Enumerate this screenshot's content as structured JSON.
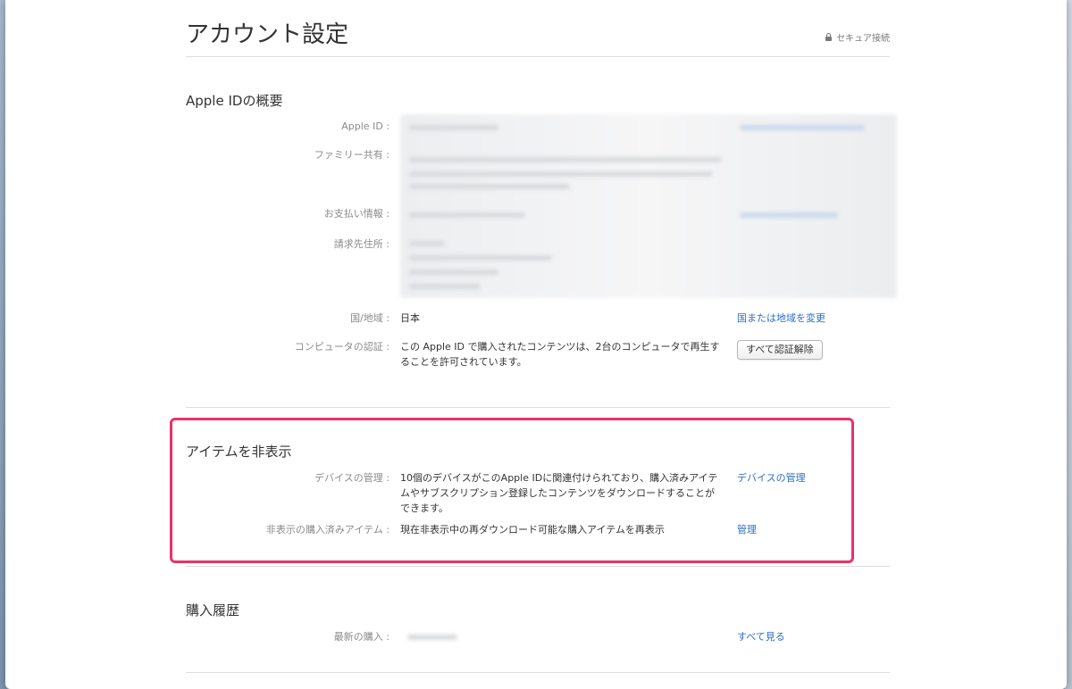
{
  "page": {
    "title": "アカウント設定",
    "secure_label": "セキュア接続"
  },
  "apple_id_summary": {
    "title": "Apple IDの概要",
    "rows": {
      "apple_id": {
        "label": "Apple ID :"
      },
      "family": {
        "label": "ファミリー共有 :"
      },
      "payment": {
        "label": "お支払い情報 :"
      },
      "billing": {
        "label": "請求先住所 :"
      },
      "country": {
        "label": "国/地域 :",
        "value": "日本",
        "action": "国または地域を変更"
      },
      "computer": {
        "label": "コンピュータの認証 :",
        "value": "この Apple ID で購入されたコンテンツは、2台のコンピュータで再生することを許可されています。",
        "action": "すべて認証解除"
      }
    }
  },
  "hide_items": {
    "title": "アイテムを非表示",
    "rows": {
      "devices": {
        "label": "デバイスの管理 :",
        "value": "10個のデバイスがこのApple IDに関連付けられており、購入済みアイテムやサブスクリプション登録したコンテンツをダウンロードすることができます。",
        "action": "デバイスの管理"
      },
      "hidden": {
        "label": "非表示の購入済みアイテム :",
        "value": "現在非表示中の再ダウンロード可能な購入アイテムを再表示",
        "action": "管理"
      }
    }
  },
  "purchase_history": {
    "title": "購入履歴",
    "rows": {
      "latest": {
        "label": "最新の購入 :",
        "action": "すべて見る"
      }
    }
  },
  "colors": {
    "link": "#2b6fc4",
    "highlight": "#e8336b",
    "label": "#8a8a8a"
  }
}
